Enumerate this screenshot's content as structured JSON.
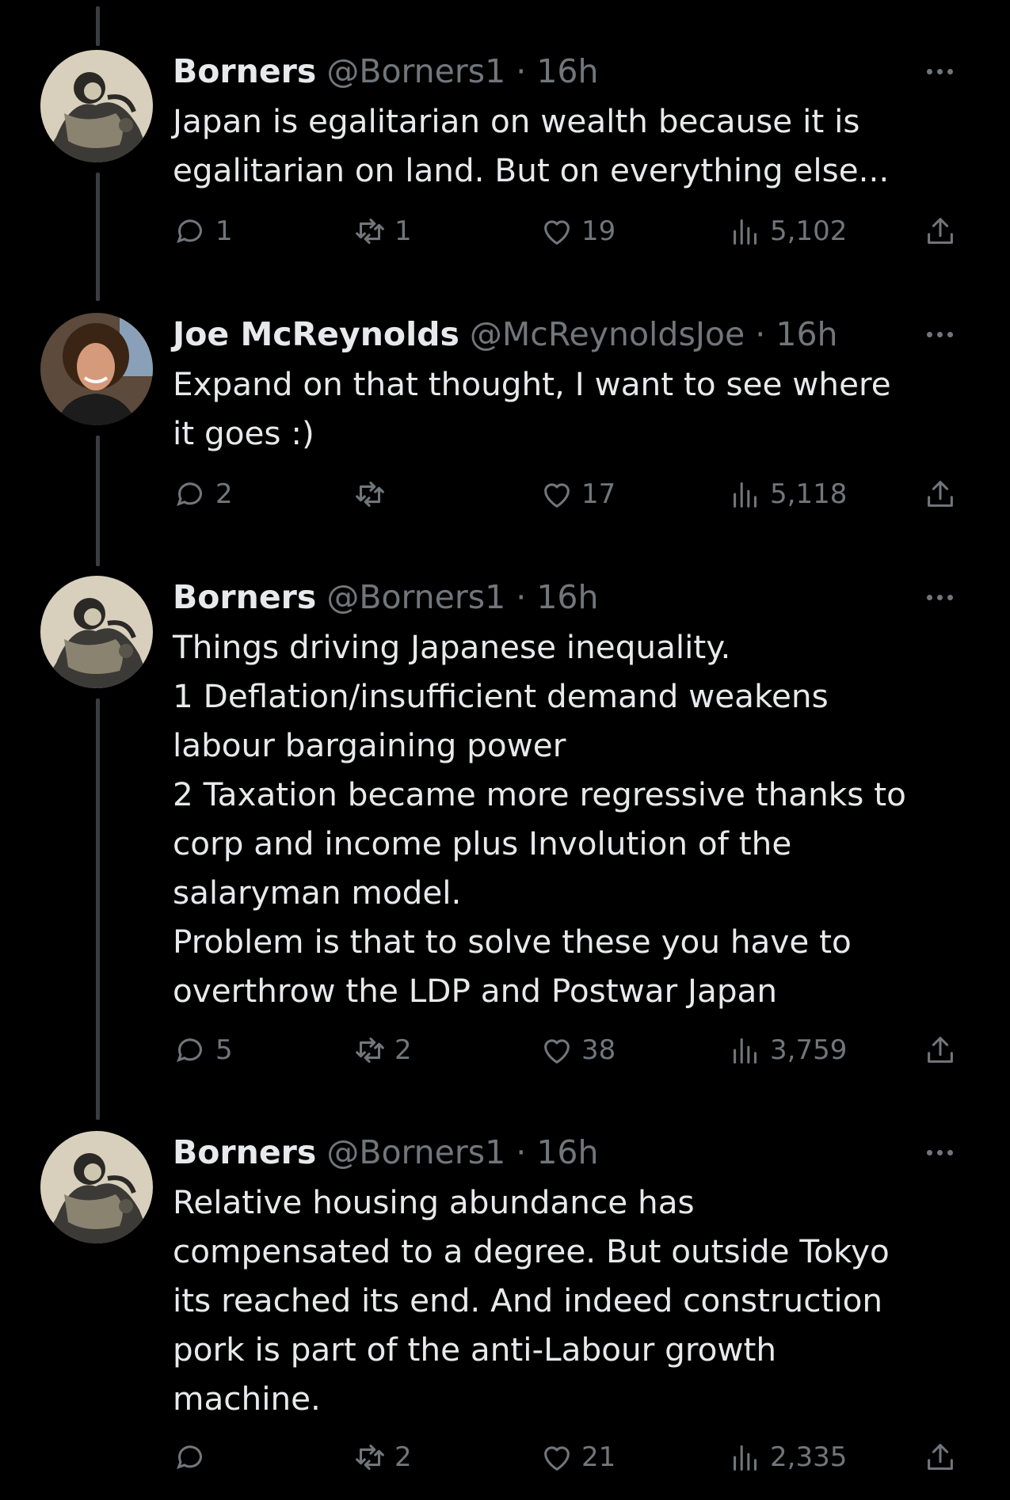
{
  "colors": {
    "background": "#000000",
    "text_primary": "#e7e9ea",
    "text_secondary": "#71767b",
    "thread_line": "#3a3d41"
  },
  "icons": {
    "reply": "speech-bubble-icon",
    "retweet": "retweet-arrows-icon",
    "like": "heart-icon",
    "views": "bar-chart-icon",
    "share": "upload-arrow-icon",
    "more": "three-dots-icon"
  },
  "tweets": [
    {
      "name": "Borners",
      "handle": "@Borners1",
      "separator": "·",
      "time": "16h",
      "lines": [
        "Japan is egalitarian on wealth because it is",
        "egalitarian on land. But on everything else..."
      ],
      "replies": "1",
      "retweets": "1",
      "likes": "19",
      "views": "5,102"
    },
    {
      "name": "Joe McReynolds",
      "handle": "@McReynoldsJoe",
      "separator": "·",
      "time": "16h",
      "lines": [
        "Expand on that thought, I want to see where",
        "it goes :)"
      ],
      "replies": "2",
      "retweets": "",
      "likes": "17",
      "views": "5,118"
    },
    {
      "name": "Borners",
      "handle": "@Borners1",
      "separator": "·",
      "time": "16h",
      "lines": [
        "Things driving Japanese inequality.",
        "1 Deflation/insufficient demand weakens",
        "labour bargaining power",
        "2 Taxation became more regressive thanks to",
        "corp and income plus Involution of the",
        "salaryman model.",
        "Problem is that to solve these you have to",
        "overthrow the LDP and Postwar Japan"
      ],
      "replies": "5",
      "retweets": "2",
      "likes": "38",
      "views": "3,759"
    },
    {
      "name": "Borners",
      "handle": "@Borners1",
      "separator": "·",
      "time": "16h",
      "lines": [
        "Relative housing abundance has",
        "compensated to a degree. But outside Tokyo",
        "its reached its end. And indeed construction",
        "pork is part of the anti-Labour growth",
        "machine."
      ],
      "replies": "",
      "retweets": "2",
      "likes": "21",
      "views": "2,335"
    }
  ]
}
